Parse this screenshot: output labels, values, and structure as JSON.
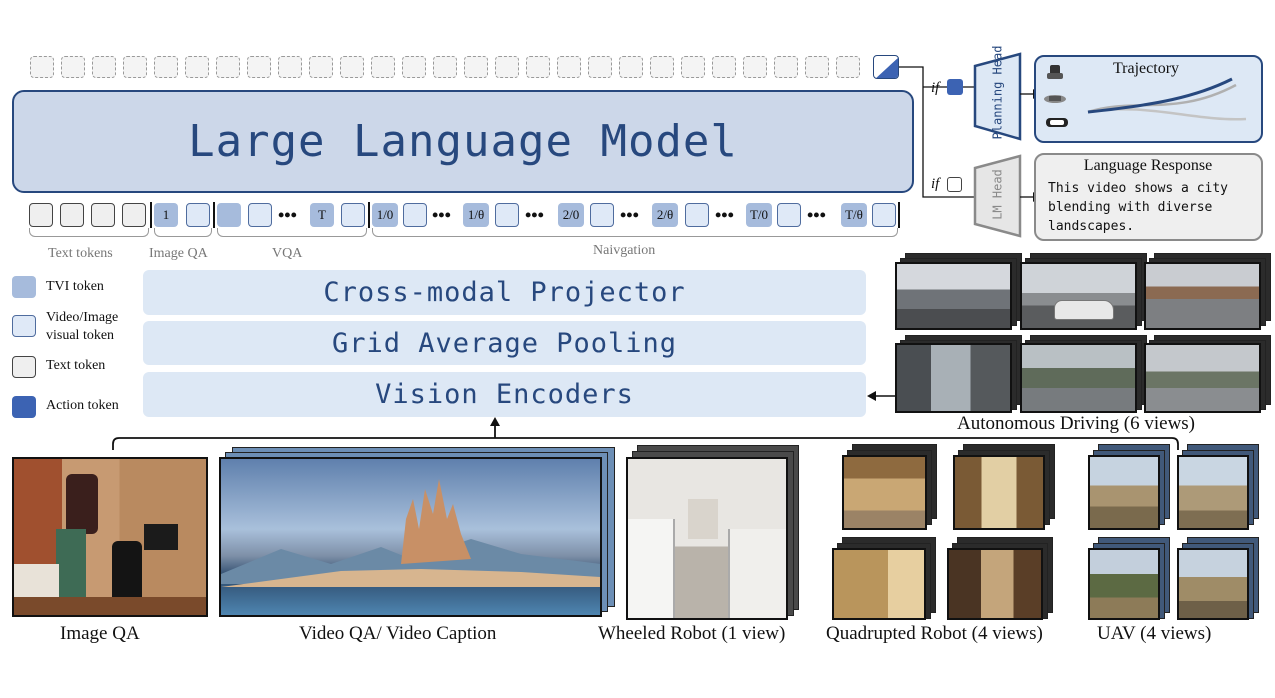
{
  "llm": {
    "title": "Large Language Model"
  },
  "heads": {
    "condition_if": "if",
    "planning_head": "Planning Head",
    "lm_head": "LM Head"
  },
  "outputs": {
    "trajectory_title": "Trajectory",
    "language_title": "Language Response",
    "language_text_line1": "This video shows a city",
    "language_text_line2": "blending with diverse",
    "language_text_line3": "landscapes."
  },
  "token_row": {
    "image_qa_token": "1",
    "vqa_token": "T",
    "nav_tokens": [
      "1/0",
      "1/θ",
      "2/0",
      "2/θ",
      "T/0",
      "T/θ"
    ],
    "ellipsis": "•••"
  },
  "groups": {
    "text_tokens": "Text tokens",
    "image_qa": "Image QA",
    "vqa": "VQA",
    "navigation": "Naivgation"
  },
  "legend": [
    {
      "label": "TVI token",
      "color": "#a6bbdc"
    },
    {
      "label": "Video/Image visual token",
      "color": "#dfe9f7"
    },
    {
      "label": "Text token",
      "color": "#efefef"
    },
    {
      "label": "Action token",
      "color": "#3c63b3"
    }
  ],
  "modules": {
    "projector": "Cross-modal Projector",
    "pooling": "Grid Average Pooling",
    "encoders": "Vision Encoders"
  },
  "captions": {
    "image_qa": "Image QA",
    "video_qa": "Video QA/ Video Caption",
    "wheeled": "Wheeled Robot (1 view)",
    "quadruped": "Quadrupted Robot (4 views)",
    "uav": "UAV (4 views)",
    "driving": "Autonomous Driving (6 views)"
  },
  "colors": {
    "accent": "#27487e",
    "action_token": "#3c63b3",
    "tvi_token": "#a6bbdc",
    "visual_token": "#dfe9f7",
    "lm_head_gray": "#e6e6e6"
  }
}
